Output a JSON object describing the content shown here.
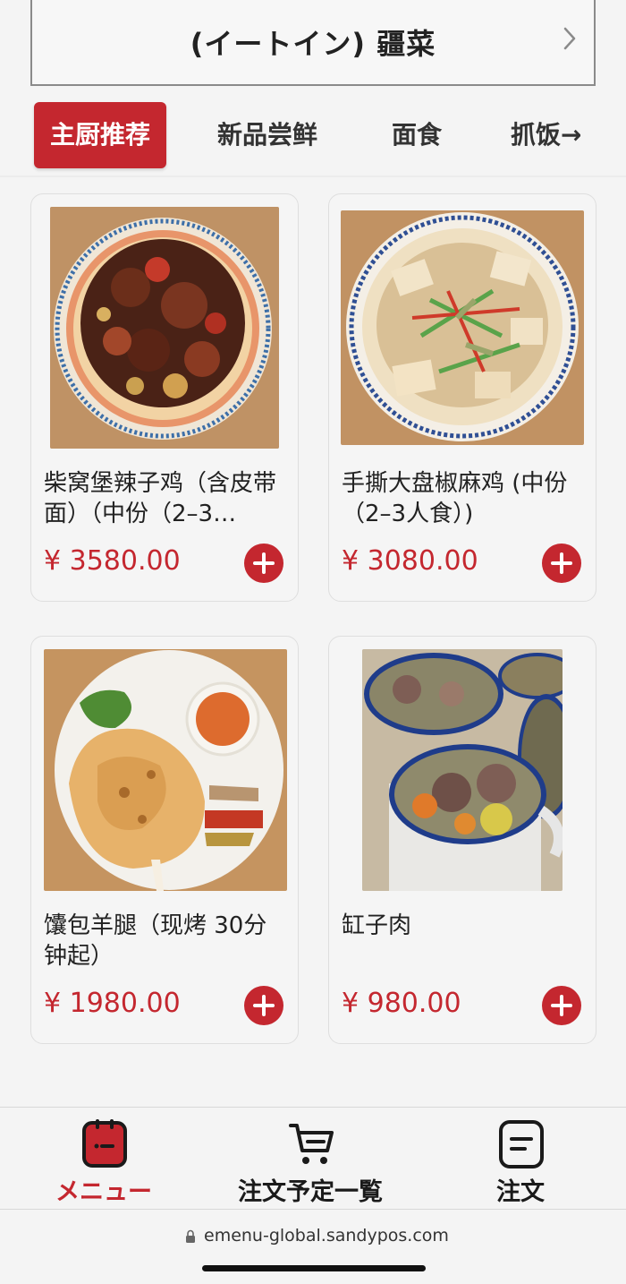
{
  "store": {
    "title": "(イートイン) 疆菜"
  },
  "tabs": [
    {
      "label": "主厨推荐",
      "active": true
    },
    {
      "label": "新品尝鲜",
      "active": false
    },
    {
      "label": "面食",
      "active": false
    },
    {
      "label": "抓饭→",
      "active": false
    }
  ],
  "products": [
    {
      "name": "柴窝堡辣子鸡（含皮带面）（中份（2–3…",
      "price": "¥ 3580.00",
      "image": "spicy-chicken-plate-photo"
    },
    {
      "name": "手撕大盘椒麻鸡 (中份（2–3人食）)",
      "price": "¥ 3080.00",
      "image": "shredded-chicken-plate-photo"
    },
    {
      "name": "馕包羊腿（现烤 30分钟起）",
      "price": "¥ 1980.00",
      "image": "naan-lamb-leg-photo"
    },
    {
      "name": "缸子肉",
      "price": "¥ 980.00",
      "image": "mutton-soup-mugs-photo"
    }
  ],
  "bottom_nav": {
    "menu": "メニュー",
    "reservations": "注文予定一覧",
    "orders": "注文"
  },
  "browser": {
    "url": "emenu-global.sandypos.com"
  },
  "colors": {
    "accent": "#c4272f",
    "background": "#f4f4f4",
    "card": "#f5f5f5"
  }
}
